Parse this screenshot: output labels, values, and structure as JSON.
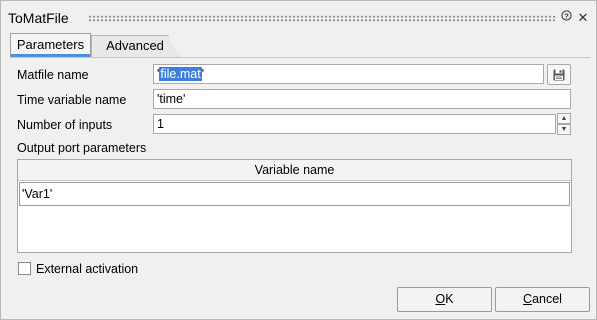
{
  "window": {
    "title": "ToMatFile",
    "help_icon": "?",
    "close_icon": "✕"
  },
  "tabs": [
    {
      "label": "Parameters",
      "active": true
    },
    {
      "label": "Advanced",
      "active": false
    }
  ],
  "form": {
    "matfile_label": "Matfile name",
    "matfile_value_prefix": "'",
    "matfile_value_selected": "file.mat",
    "matfile_value_suffix": "'",
    "time_label": "Time variable name",
    "time_value": "'time'",
    "inputs_label": "Number of inputs",
    "inputs_value": "1",
    "output_section_label": "Output port parameters"
  },
  "table": {
    "header": "Variable name",
    "rows": [
      "'Var1'"
    ]
  },
  "external_activation": {
    "label": "External activation",
    "checked": false
  },
  "buttons": {
    "ok_mnemonic": "O",
    "ok_rest": "K",
    "cancel_mnemonic": "C",
    "cancel_rest": "ancel"
  },
  "colors": {
    "selection": "#3d7fd9",
    "active_tab_accent": "#4a90d9"
  }
}
